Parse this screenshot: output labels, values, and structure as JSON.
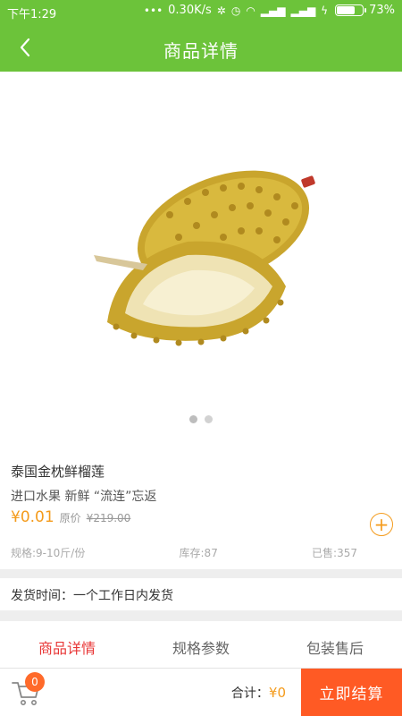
{
  "status_bar": {
    "time": "下午1:29",
    "network_speed": "0.30K/s",
    "battery_percent": "73%",
    "battery_level": 0.73
  },
  "header": {
    "title": "商品详情",
    "back_icon": "chevron-left-icon"
  },
  "gallery": {
    "image_subject": "durian",
    "page_count": 2,
    "active_index": 0
  },
  "product": {
    "name": "泰国金枕鲜榴莲",
    "subtitle": "进口水果 新鲜 “流连”忘返",
    "price": "¥0.01",
    "original_label": "原价",
    "original_price": "¥219.00",
    "add_icon": "plus-circle-icon",
    "spec": "规格:9-10斤/份",
    "stock": "库存:87",
    "sold": "已售:357"
  },
  "shipping": {
    "text": "发货时间：一个工作日内发货"
  },
  "tabs": [
    {
      "label": "商品详情",
      "active": true
    },
    {
      "label": "规格参数",
      "active": false
    },
    {
      "label": "包装售后",
      "active": false
    }
  ],
  "bottom_bar": {
    "cart_icon": "cart-icon",
    "cart_count": "0",
    "total_label": "合计：",
    "total_amount": "¥0",
    "checkout_label": "立即结算"
  },
  "colors": {
    "brand_green": "#6cc33a",
    "price_orange": "#f49b1c",
    "tab_active_red": "#e83535",
    "checkout_orange": "#ff5a24"
  }
}
